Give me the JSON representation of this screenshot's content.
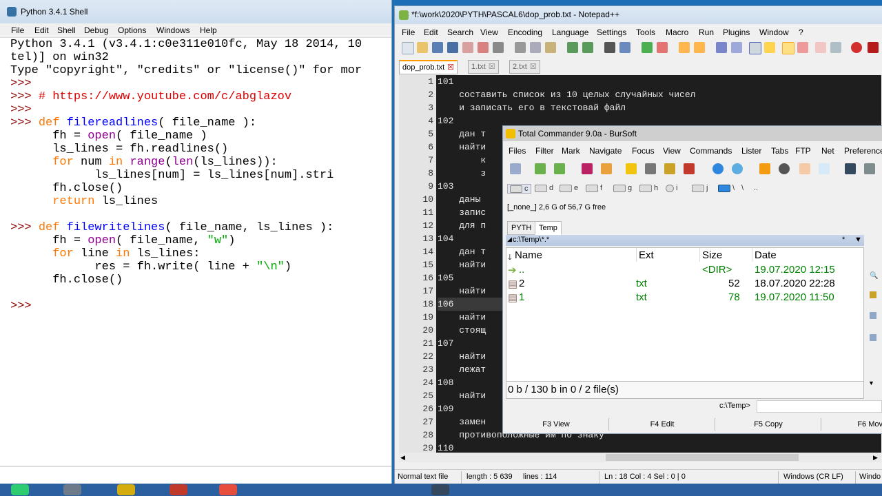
{
  "shell": {
    "title": "Python 3.4.1 Shell",
    "menu": [
      "File",
      "Edit",
      "Shell",
      "Debug",
      "Options",
      "Windows",
      "Help"
    ],
    "lines": [
      [
        [
          "Python 3.4.1 (v3.4.1:c0e311e010fc, May 18 2014, 10",
          ""
        ]
      ],
      [
        [
          "tel)] on win32",
          ""
        ]
      ],
      [
        [
          "Type \"copyright\", \"credits\" or \"license()\" for mor",
          ""
        ]
      ],
      [
        [
          ">>> ",
          "pr"
        ]
      ],
      [
        [
          ">>> ",
          "pr"
        ],
        [
          "# https://www.youtube.com/c/abglazov",
          "cm"
        ]
      ],
      [
        [
          ">>> ",
          "pr"
        ]
      ],
      [
        [
          ">>> ",
          "pr"
        ],
        [
          "def ",
          "kw"
        ],
        [
          "filereadlines",
          "fn"
        ],
        [
          "( file_name ):",
          ""
        ]
      ],
      [
        [
          "      fh = ",
          ""
        ],
        [
          "open",
          "bi"
        ],
        [
          "( file_name )",
          ""
        ]
      ],
      [
        [
          "      ls_lines = fh.readlines()",
          ""
        ]
      ],
      [
        [
          "      ",
          ""
        ],
        [
          "for ",
          "kw"
        ],
        [
          "num ",
          ""
        ],
        [
          "in ",
          "kw"
        ],
        [
          "range",
          "bi"
        ],
        [
          "(",
          ""
        ],
        [
          "len",
          "bi"
        ],
        [
          "(ls_lines)):",
          ""
        ]
      ],
      [
        [
          "            ls_lines[num] = ls_lines[num].stri",
          ""
        ]
      ],
      [
        [
          "      fh.close()",
          ""
        ]
      ],
      [
        [
          "      ",
          ""
        ],
        [
          "return ",
          "kw"
        ],
        [
          "ls_lines",
          ""
        ]
      ],
      [
        [
          "",
          ""
        ]
      ],
      [
        [
          ">>> ",
          "pr"
        ],
        [
          "def ",
          "kw"
        ],
        [
          "filewritelines",
          "fn"
        ],
        [
          "( file_name, ls_lines ):",
          ""
        ]
      ],
      [
        [
          "      fh = ",
          ""
        ],
        [
          "open",
          "bi"
        ],
        [
          "( file_name, ",
          ""
        ],
        [
          "\"w\"",
          "st"
        ],
        [
          ")",
          ""
        ]
      ],
      [
        [
          "      ",
          ""
        ],
        [
          "for ",
          "kw"
        ],
        [
          "line ",
          ""
        ],
        [
          "in ",
          "kw"
        ],
        [
          "ls_lines:",
          ""
        ]
      ],
      [
        [
          "            res = fh.write( line + ",
          ""
        ],
        [
          "\"\\n\"",
          "st"
        ],
        [
          ")",
          ""
        ]
      ],
      [
        [
          "      fh.close()",
          ""
        ]
      ],
      [
        [
          "",
          ""
        ]
      ],
      [
        [
          ">>> ",
          "pr"
        ]
      ]
    ]
  },
  "npp": {
    "title": "*f:\\work\\2020\\PYTH\\PASCAL6\\dop_prob.txt - Notepad++",
    "menu": [
      "File",
      "Edit",
      "Search",
      "View",
      "Encoding",
      "Language",
      "Settings",
      "Tools",
      "Macro",
      "Run",
      "Plugins",
      "Window",
      "?"
    ],
    "tabs": [
      "dop_prob.txt",
      "1.txt",
      "2.txt"
    ],
    "line_numbers": [
      "1",
      "2",
      "3",
      "4",
      "5",
      "6",
      "7",
      "8",
      "9",
      "10",
      "11",
      "12",
      "13",
      "14",
      "15",
      "16",
      "17",
      "18",
      "19",
      "20",
      "21",
      "22",
      "23",
      "24",
      "25",
      "26",
      "27",
      "28",
      "29"
    ],
    "text_lines": [
      "101",
      "    составить список из 10 целых случайных чисел",
      "    и записать его в текстовай файл",
      "102",
      "    дан т",
      "    найти",
      "        к",
      "        з",
      "103",
      "    даны ",
      "    запис",
      "    для п",
      "104",
      "    дан т",
      "    найти",
      "105",
      "    найти",
      "106",
      "    найти",
      "    стоящ",
      "107",
      "    найти",
      "    лежат",
      "108",
      "    найти",
      "109",
      "    замен",
      "    противоположные им по знаку",
      "110"
    ],
    "status": {
      "type": "Normal text file",
      "length": "length : 5 639",
      "lines": "lines : 114",
      "position": "Ln : 18    Col : 4    Sel : 0 | 0",
      "eol": "Windows (CR LF)",
      "extra": "Windo"
    }
  },
  "tc": {
    "title": "Total Commander 9.0a - BurSoft",
    "menu": [
      "Files",
      "Filter",
      "Mark",
      "Navigate",
      "Focus",
      "View",
      "Commands",
      "Lister",
      "Tabs",
      "FTP",
      "Net",
      "Preference"
    ],
    "drives": [
      "c",
      "d",
      "e",
      "f",
      "g",
      "h",
      "i",
      "j",
      "\\",
      ".."
    ],
    "drive_info": "[_none_]  2,6 G of 56,7 G free",
    "panel_tabs": [
      "PYTH",
      "Temp"
    ],
    "path": "c:\\Temp\\*.*",
    "path_filter": "*",
    "columns": [
      "Name",
      "Ext",
      "Size",
      "Date"
    ],
    "rows": [
      {
        "name": "..",
        "ext": "",
        "size": "<DIR>",
        "date": "19.07.2020 12:15"
      },
      {
        "name": "2",
        "ext": "txt",
        "size": "52",
        "date": "18.07.2020 22:28"
      },
      {
        "name": "1",
        "ext": "txt",
        "size": "78",
        "date": "19.07.2020 11:50"
      }
    ],
    "panel_status": "0 b / 130 b in 0 / 2 file(s)",
    "cmd_label": "c:\\Temp>",
    "fkeys": [
      "F3 View",
      "F4 Edit",
      "F5 Copy",
      "F6 Mov"
    ]
  },
  "colors": {
    "python_keyword": "#ff7700",
    "python_defname": "#0000ff",
    "python_builtin": "#900090",
    "python_string": "#00aa00",
    "python_comment": "#dd0000",
    "python_prompt": "#900000",
    "editor_bg": "#1e1e1e",
    "tc_file_green": "#008000"
  }
}
